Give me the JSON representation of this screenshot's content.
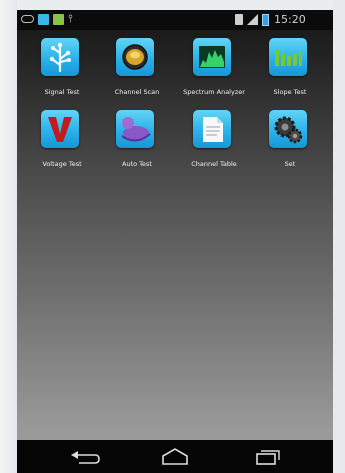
{
  "status_bar": {
    "time": "15:20",
    "icons": [
      "usb-icon",
      "image-icon",
      "gallery-icon",
      "wifi-icon",
      "sim-icon",
      "signal-icon",
      "battery-icon"
    ]
  },
  "apps": [
    {
      "label": "Signal Test",
      "icon": "signal-tree-icon"
    },
    {
      "label": "Channel Scan",
      "icon": "satellite-dish-icon"
    },
    {
      "label": "Spectrum Analyzer",
      "icon": "spectrum-icon"
    },
    {
      "label": "Slope Test",
      "icon": "slope-bars-icon"
    },
    {
      "label": "Voltage Test",
      "icon": "voltage-v-icon"
    },
    {
      "label": "Auto Test",
      "icon": "auto-test-icon"
    },
    {
      "label": "Channel Table",
      "icon": "document-icon"
    },
    {
      "label": "Set",
      "icon": "gears-icon"
    }
  ],
  "nav_bar": {
    "buttons": [
      "back-icon",
      "home-icon",
      "recent-apps-icon"
    ]
  }
}
